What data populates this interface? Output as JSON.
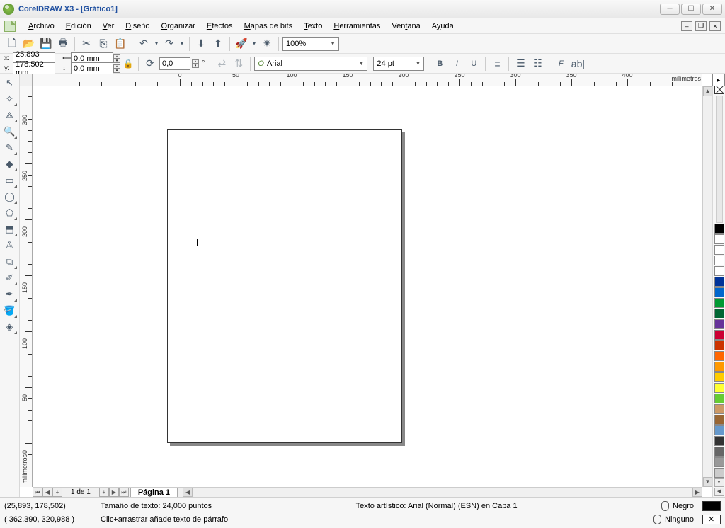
{
  "title": "CorelDRAW X3 - [Gráfico1]",
  "menu": [
    "Archivo",
    "Edición",
    "Ver",
    "Diseño",
    "Organizar",
    "Efectos",
    "Mapas de bits",
    "Texto",
    "Herramientas",
    "Ventana",
    "Ayuda"
  ],
  "menu_underline": [
    0,
    0,
    0,
    0,
    0,
    0,
    0,
    0,
    0,
    3,
    1
  ],
  "zoom": "100%",
  "property_bar": {
    "x": "25.893 mm",
    "y": "178.502 mm",
    "w": "0.0 mm",
    "h": "0.0 mm",
    "angle": "0,0",
    "font": "Arial",
    "font_size": "24 pt"
  },
  "ruler_units": "milímetros",
  "ruler_h_ticks": [
    0,
    50,
    100,
    150,
    200,
    250,
    300,
    350,
    400
  ],
  "ruler_v_ticks": [
    0,
    50,
    100,
    150,
    200,
    250,
    300
  ],
  "page_nav": {
    "counter": "1 de 1",
    "tab": "Página 1"
  },
  "palette": [
    "#000000",
    "#ffffff",
    "#ffffff",
    "#ffffff",
    "#ffffff",
    "#003399",
    "#0066cc",
    "#009933",
    "#006633",
    "#663399",
    "#cc0033",
    "#cc3300",
    "#ff6600",
    "#ff9900",
    "#ffcc00",
    "#ffff33",
    "#66cc33",
    "#cc9966",
    "#996633",
    "#6699cc",
    "#333333",
    "#666666",
    "#999999",
    "#cccccc"
  ],
  "status": {
    "coords": "(25,893, 178,502)",
    "text_size": "Tamaño de texto: 24,000 puntos",
    "object_info": "Texto artístico: Arial (Normal) (ESN) en Capa 1",
    "coords2": "( 362,390, 320,988 )",
    "hint": "Clic+arrastrar añade texto de párrafo",
    "fill_label": "Negro",
    "outline_label": "Ninguno",
    "fill_color": "#000000"
  }
}
